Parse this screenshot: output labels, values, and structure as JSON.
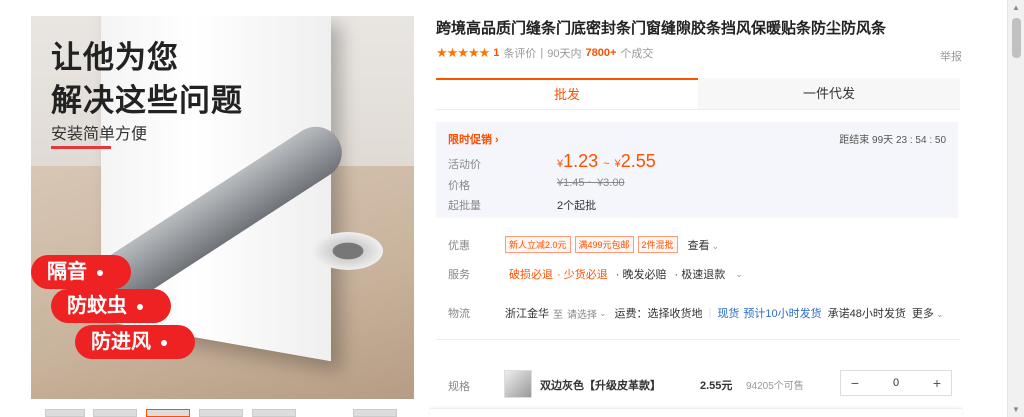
{
  "hero": {
    "headline_1": "让他为您",
    "headline_2": "解决这些问题",
    "subtitle": "安装简单方便",
    "tags": [
      "隔音",
      "防蚊虫",
      "防进风"
    ]
  },
  "product": {
    "title": "跨境高品质门缝条门底密封条门窗缝隙胶条挡风保暖贴条防尘防风条",
    "stars": "★★★★★",
    "review_count": "1",
    "review_label": "条评价",
    "sep": "|",
    "sales_prefix": "90天内",
    "sales_count": "7800+",
    "sales_suffix": "个成交",
    "report": "举报"
  },
  "tabs": [
    "批发",
    "一件代发"
  ],
  "promo": {
    "label": "限时促销 ›",
    "countdown": "距结束 99天 23 : 54 : 50",
    "price_label": "活动价",
    "price_from_sym": "¥",
    "price_from": "1.23",
    "price_sep": "~",
    "price_to_sym": "¥",
    "price_to": "2.55",
    "old_label": "价格",
    "old_price": "¥1.45 ~ ¥3.00",
    "moq_label": "起批量",
    "moq": "2个起批"
  },
  "offers": {
    "label": "优惠",
    "badges": [
      "新人立减2.0元",
      "满499元包邮",
      "2件混批"
    ],
    "view": "查看"
  },
  "service": {
    "label": "服务",
    "items": [
      "破损必退",
      "少货必退",
      "晚发必赔",
      "极速退款"
    ]
  },
  "logistics": {
    "label": "物流",
    "origin": "浙江金华",
    "to": "至",
    "dest": "请选择",
    "fee": "运费：选择收货地",
    "stock_label": "现货",
    "eta": "预计10小时发货",
    "promise": "承诺48小时发货",
    "more": "更多"
  },
  "spec": {
    "label": "规格",
    "name": "双边灰色【升级皮革款】",
    "price": "2.55元",
    "stock": "94205个可售",
    "minus": "−",
    "qty": "0",
    "plus": "+"
  },
  "colors": {
    "accent": "#ff5000",
    "tag_red": "#e22222",
    "link_blue": "#2a6ccf"
  }
}
